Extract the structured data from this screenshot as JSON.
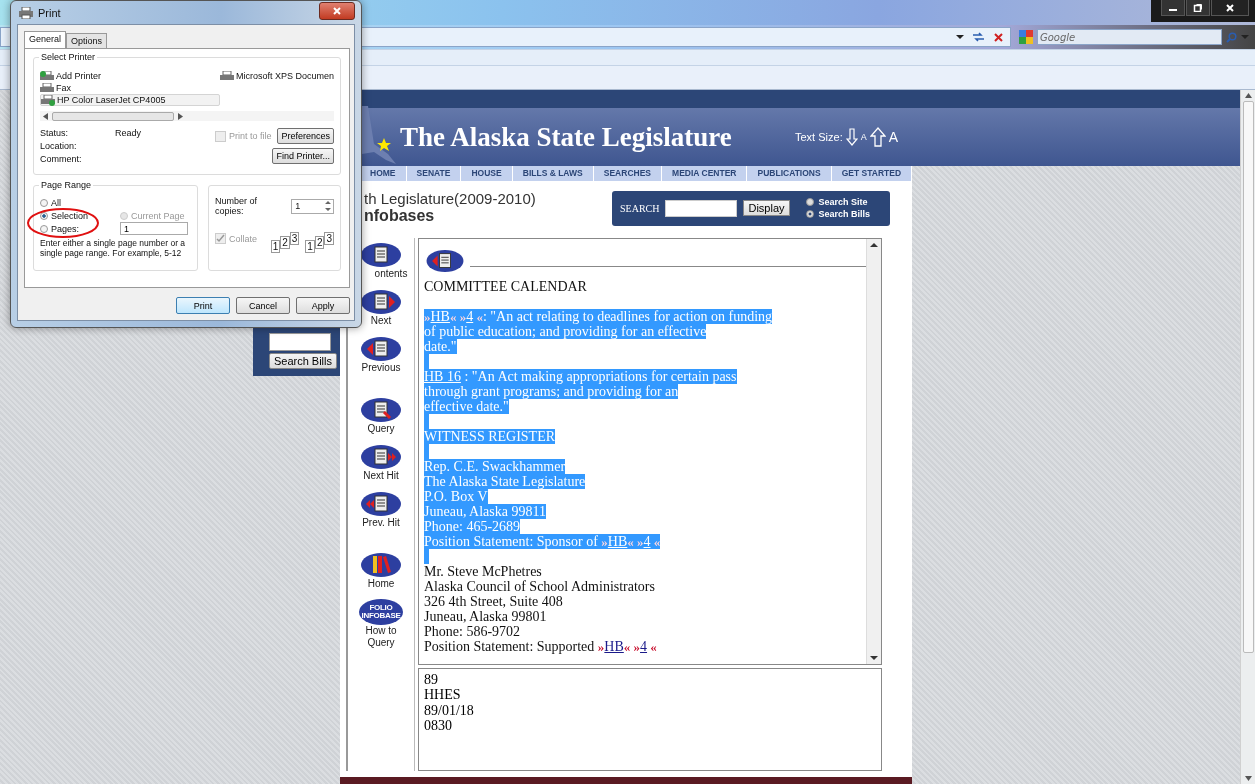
{
  "browser": {
    "search_placeholder": "Google"
  },
  "print_dialog": {
    "title": "Print",
    "tabs": [
      {
        "label": "General",
        "selected": true
      },
      {
        "label": "Options",
        "selected": false
      }
    ],
    "select_printer": {
      "legend": "Select Printer",
      "printers": [
        {
          "name": "Add Printer",
          "kind": "add",
          "selected": false
        },
        {
          "name": "Fax",
          "kind": "fax",
          "selected": false
        },
        {
          "name": "HP Color LaserJet CP4005",
          "kind": "default",
          "selected": true
        },
        {
          "name": "Microsoft XPS Documen",
          "kind": "printer",
          "selected": false
        }
      ],
      "status_label": "Status:",
      "status_value": "Ready",
      "location_label": "Location:",
      "comment_label": "Comment:",
      "print_to_file": {
        "label": "Print to file",
        "checked": false,
        "disabled": true
      },
      "preferences": "Preferences",
      "find_printer": "Find Printer..."
    },
    "page_range": {
      "legend": "Page Range",
      "options": [
        {
          "label": "All",
          "selected": false,
          "disabled": false
        },
        {
          "label": "Selection",
          "selected": true,
          "disabled": false
        },
        {
          "label": "Current Page",
          "selected": false,
          "disabled": true
        },
        {
          "label": "Pages:",
          "selected": false,
          "disabled": false
        }
      ],
      "pages_value": "1",
      "hint": "Enter either a single page number or a single page range.  For example, 5-12"
    },
    "copies": {
      "label": "Number of copies:",
      "value": "1",
      "collate": {
        "label": "Collate",
        "checked": true,
        "disabled": true
      },
      "collate_icons": [
        [
          "1",
          "2",
          "3"
        ],
        [
          "1",
          "2",
          "3"
        ]
      ]
    },
    "buttons": [
      "Print",
      "Cancel",
      "Apply"
    ]
  },
  "site": {
    "title": "The Alaska State Legislature",
    "text_size_label": "Text Size:",
    "text_size_small": "A",
    "text_size_large": "A",
    "nav": [
      "HOME",
      "SENATE",
      "HOUSE",
      "BILLS & LAWS",
      "SEARCHES",
      "MEDIA CENTER",
      "PUBLICATIONS",
      "GET STARTED"
    ],
    "legislature": "th Legislature(2009-2010)",
    "heading": "nfobases",
    "search": {
      "label": "SEARCH",
      "button": "Display",
      "scopes": [
        {
          "label": "Search Site",
          "selected": false
        },
        {
          "label": "Search Bills",
          "selected": true
        }
      ]
    },
    "side_button": "Search Bills"
  },
  "infobase": {
    "toolbar": [
      {
        "label": "ontents",
        "kind": "contents"
      },
      {
        "label": "Next",
        "kind": "next"
      },
      {
        "label": "Previous",
        "kind": "previous"
      },
      {
        "label": "Query",
        "kind": "query"
      },
      {
        "label": "Next Hit",
        "kind": "next-hit"
      },
      {
        "label": "Prev. Hit",
        "kind": "prev-hit"
      },
      {
        "label": "Home",
        "kind": "home"
      },
      {
        "label": "How to Query",
        "kind": "how-to",
        "icon_text": "FOLIO INFOBASE"
      }
    ],
    "document": [
      {
        "kind": "text",
        "selected": false,
        "segments": [
          {
            "kind": "plain",
            "text": "COMMITTEE CALENDAR"
          }
        ]
      },
      {
        "kind": "blank",
        "selected": false
      },
      {
        "kind": "text",
        "selected": true,
        "segments": [
          {
            "kind": "marker",
            "text": "»"
          },
          {
            "kind": "link",
            "text": "HB"
          },
          {
            "kind": "marker",
            "text": "«"
          },
          {
            "kind": "marker",
            "text": " »"
          },
          {
            "kind": "link",
            "text": "4"
          },
          {
            "kind": "marker",
            "text": " «"
          },
          {
            "kind": "plain",
            "text": ": \"An act relating to deadlines for action on funding"
          }
        ]
      },
      {
        "kind": "text",
        "selected": true,
        "segments": [
          {
            "kind": "plain",
            "text": "of public education; and providing for an effective"
          }
        ]
      },
      {
        "kind": "text",
        "selected": true,
        "segments": [
          {
            "kind": "plain",
            "text": "date.\""
          }
        ]
      },
      {
        "kind": "blank",
        "selected": true
      },
      {
        "kind": "text",
        "selected": true,
        "segments": [
          {
            "kind": "link",
            "text": "HB 16"
          },
          {
            "kind": "plain",
            "text": " : \"An Act making appropriations for certain pass"
          }
        ]
      },
      {
        "kind": "text",
        "selected": true,
        "segments": [
          {
            "kind": "plain",
            "text": "through grant programs; and providing for an"
          }
        ]
      },
      {
        "kind": "text",
        "selected": true,
        "segments": [
          {
            "kind": "plain",
            "text": "effective date.\""
          }
        ]
      },
      {
        "kind": "blank",
        "selected": true
      },
      {
        "kind": "text",
        "selected": true,
        "segments": [
          {
            "kind": "plain",
            "text": "WITNESS REGISTER"
          }
        ]
      },
      {
        "kind": "blank",
        "selected": true
      },
      {
        "kind": "text",
        "selected": true,
        "segments": [
          {
            "kind": "plain",
            "text": "Rep. C.E. Swackhammer"
          }
        ]
      },
      {
        "kind": "text",
        "selected": true,
        "segments": [
          {
            "kind": "plain",
            "text": "The Alaska State Legislature"
          }
        ]
      },
      {
        "kind": "text",
        "selected": true,
        "segments": [
          {
            "kind": "plain",
            "text": "P.O. Box V"
          }
        ]
      },
      {
        "kind": "text",
        "selected": true,
        "segments": [
          {
            "kind": "plain",
            "text": "Juneau, Alaska 99811"
          }
        ]
      },
      {
        "kind": "text",
        "selected": true,
        "segments": [
          {
            "kind": "plain",
            "text": "Phone: 465-2689"
          }
        ]
      },
      {
        "kind": "text",
        "selected": true,
        "segments": [
          {
            "kind": "plain",
            "text": "Position Statement: Sponsor of "
          },
          {
            "kind": "marker",
            "text": "»"
          },
          {
            "kind": "link",
            "text": "HB"
          },
          {
            "kind": "marker",
            "text": "«"
          },
          {
            "kind": "marker",
            "text": " »"
          },
          {
            "kind": "link",
            "text": "4"
          },
          {
            "kind": "marker",
            "text": " «"
          }
        ]
      },
      {
        "kind": "blank",
        "selected": true
      },
      {
        "kind": "text",
        "selected": false,
        "segments": [
          {
            "kind": "plain",
            "text": "Mr. Steve McPhetres"
          }
        ]
      },
      {
        "kind": "text",
        "selected": false,
        "segments": [
          {
            "kind": "plain",
            "text": "Alaska Council of School Administrators"
          }
        ]
      },
      {
        "kind": "text",
        "selected": false,
        "segments": [
          {
            "kind": "plain",
            "text": "326 4th Street, Suite 408"
          }
        ]
      },
      {
        "kind": "text",
        "selected": false,
        "segments": [
          {
            "kind": "plain",
            "text": "Juneau, Alaska 99801"
          }
        ]
      },
      {
        "kind": "text",
        "selected": false,
        "segments": [
          {
            "kind": "plain",
            "text": "Phone: 586-9702"
          }
        ]
      },
      {
        "kind": "text",
        "selected": false,
        "segments": [
          {
            "kind": "plain",
            "text": "Position Statement: Supported "
          },
          {
            "kind": "marker",
            "text": "»"
          },
          {
            "kind": "link",
            "text": "HB"
          },
          {
            "kind": "marker",
            "text": "«"
          },
          {
            "kind": "marker",
            "text": " »"
          },
          {
            "kind": "link",
            "text": "4"
          },
          {
            "kind": "marker",
            "text": " «"
          }
        ]
      }
    ],
    "record": [
      "89",
      "HHES",
      "89/01/18",
      "0830"
    ]
  }
}
